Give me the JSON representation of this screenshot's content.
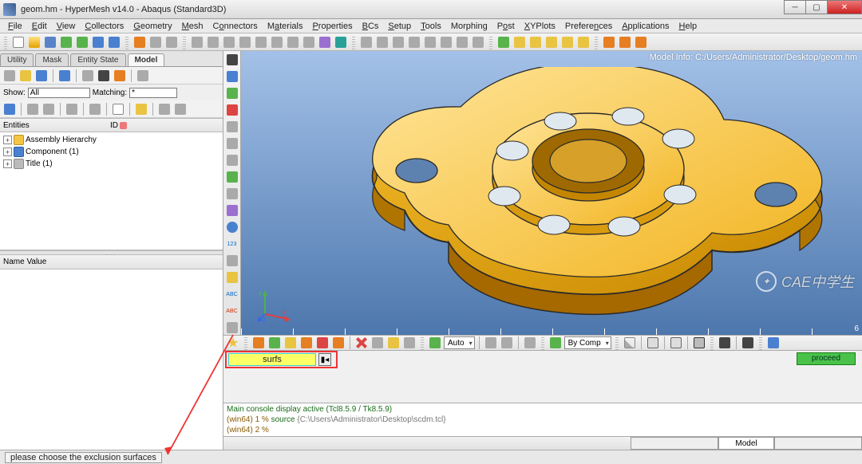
{
  "window": {
    "title": "geom.hm - HyperMesh v14.0 - Abaqus (Standard3D)"
  },
  "menu": [
    "File",
    "Edit",
    "View",
    "Collectors",
    "Geometry",
    "Mesh",
    "Connectors",
    "Materials",
    "Properties",
    "BCs",
    "Setup",
    "Tools",
    "Morphing",
    "Post",
    "XYPlots",
    "Preferences",
    "Applications",
    "Help"
  ],
  "left_tabs": [
    "Utility",
    "Mask",
    "Entity State",
    "Model"
  ],
  "active_left_tab": "Model",
  "show_label": "Show:",
  "show_value": "All",
  "matching_label": "Matching:",
  "matching_value": "*",
  "entities_header": "Entities",
  "id_header": "ID",
  "tree": [
    {
      "label": "Assembly Hierarchy"
    },
    {
      "label": "Component (1)"
    },
    {
      "label": "Title (1)"
    }
  ],
  "props_header": "Name Value",
  "viewport": {
    "model_info": "Model Info: C:/Users/Administrator/Desktop/geom.hm",
    "axis_labels": {
      "x": "x",
      "y": "y",
      "z": "z"
    },
    "ruler_end": "6"
  },
  "display_toolbar": {
    "auto_label": "Auto",
    "bycomp_label": "By Comp"
  },
  "selection": {
    "surfs_label": "surfs",
    "proceed_label": "proceed"
  },
  "console": {
    "line1": "Main console display active (Tcl8.5.9 / Tk8.5.9)",
    "line2_prefix": "(win64) 1 % ",
    "line2_cmd": "source",
    "line2_path": "{C:\\Users\\Administrator\\Desktop\\scdm.tcl}",
    "line3": "(win64) 2 %"
  },
  "bottom_tabs": {
    "empty": "",
    "model": "Model"
  },
  "status": "please choose the exclusion surfaces",
  "watermark": "CAE中学生"
}
